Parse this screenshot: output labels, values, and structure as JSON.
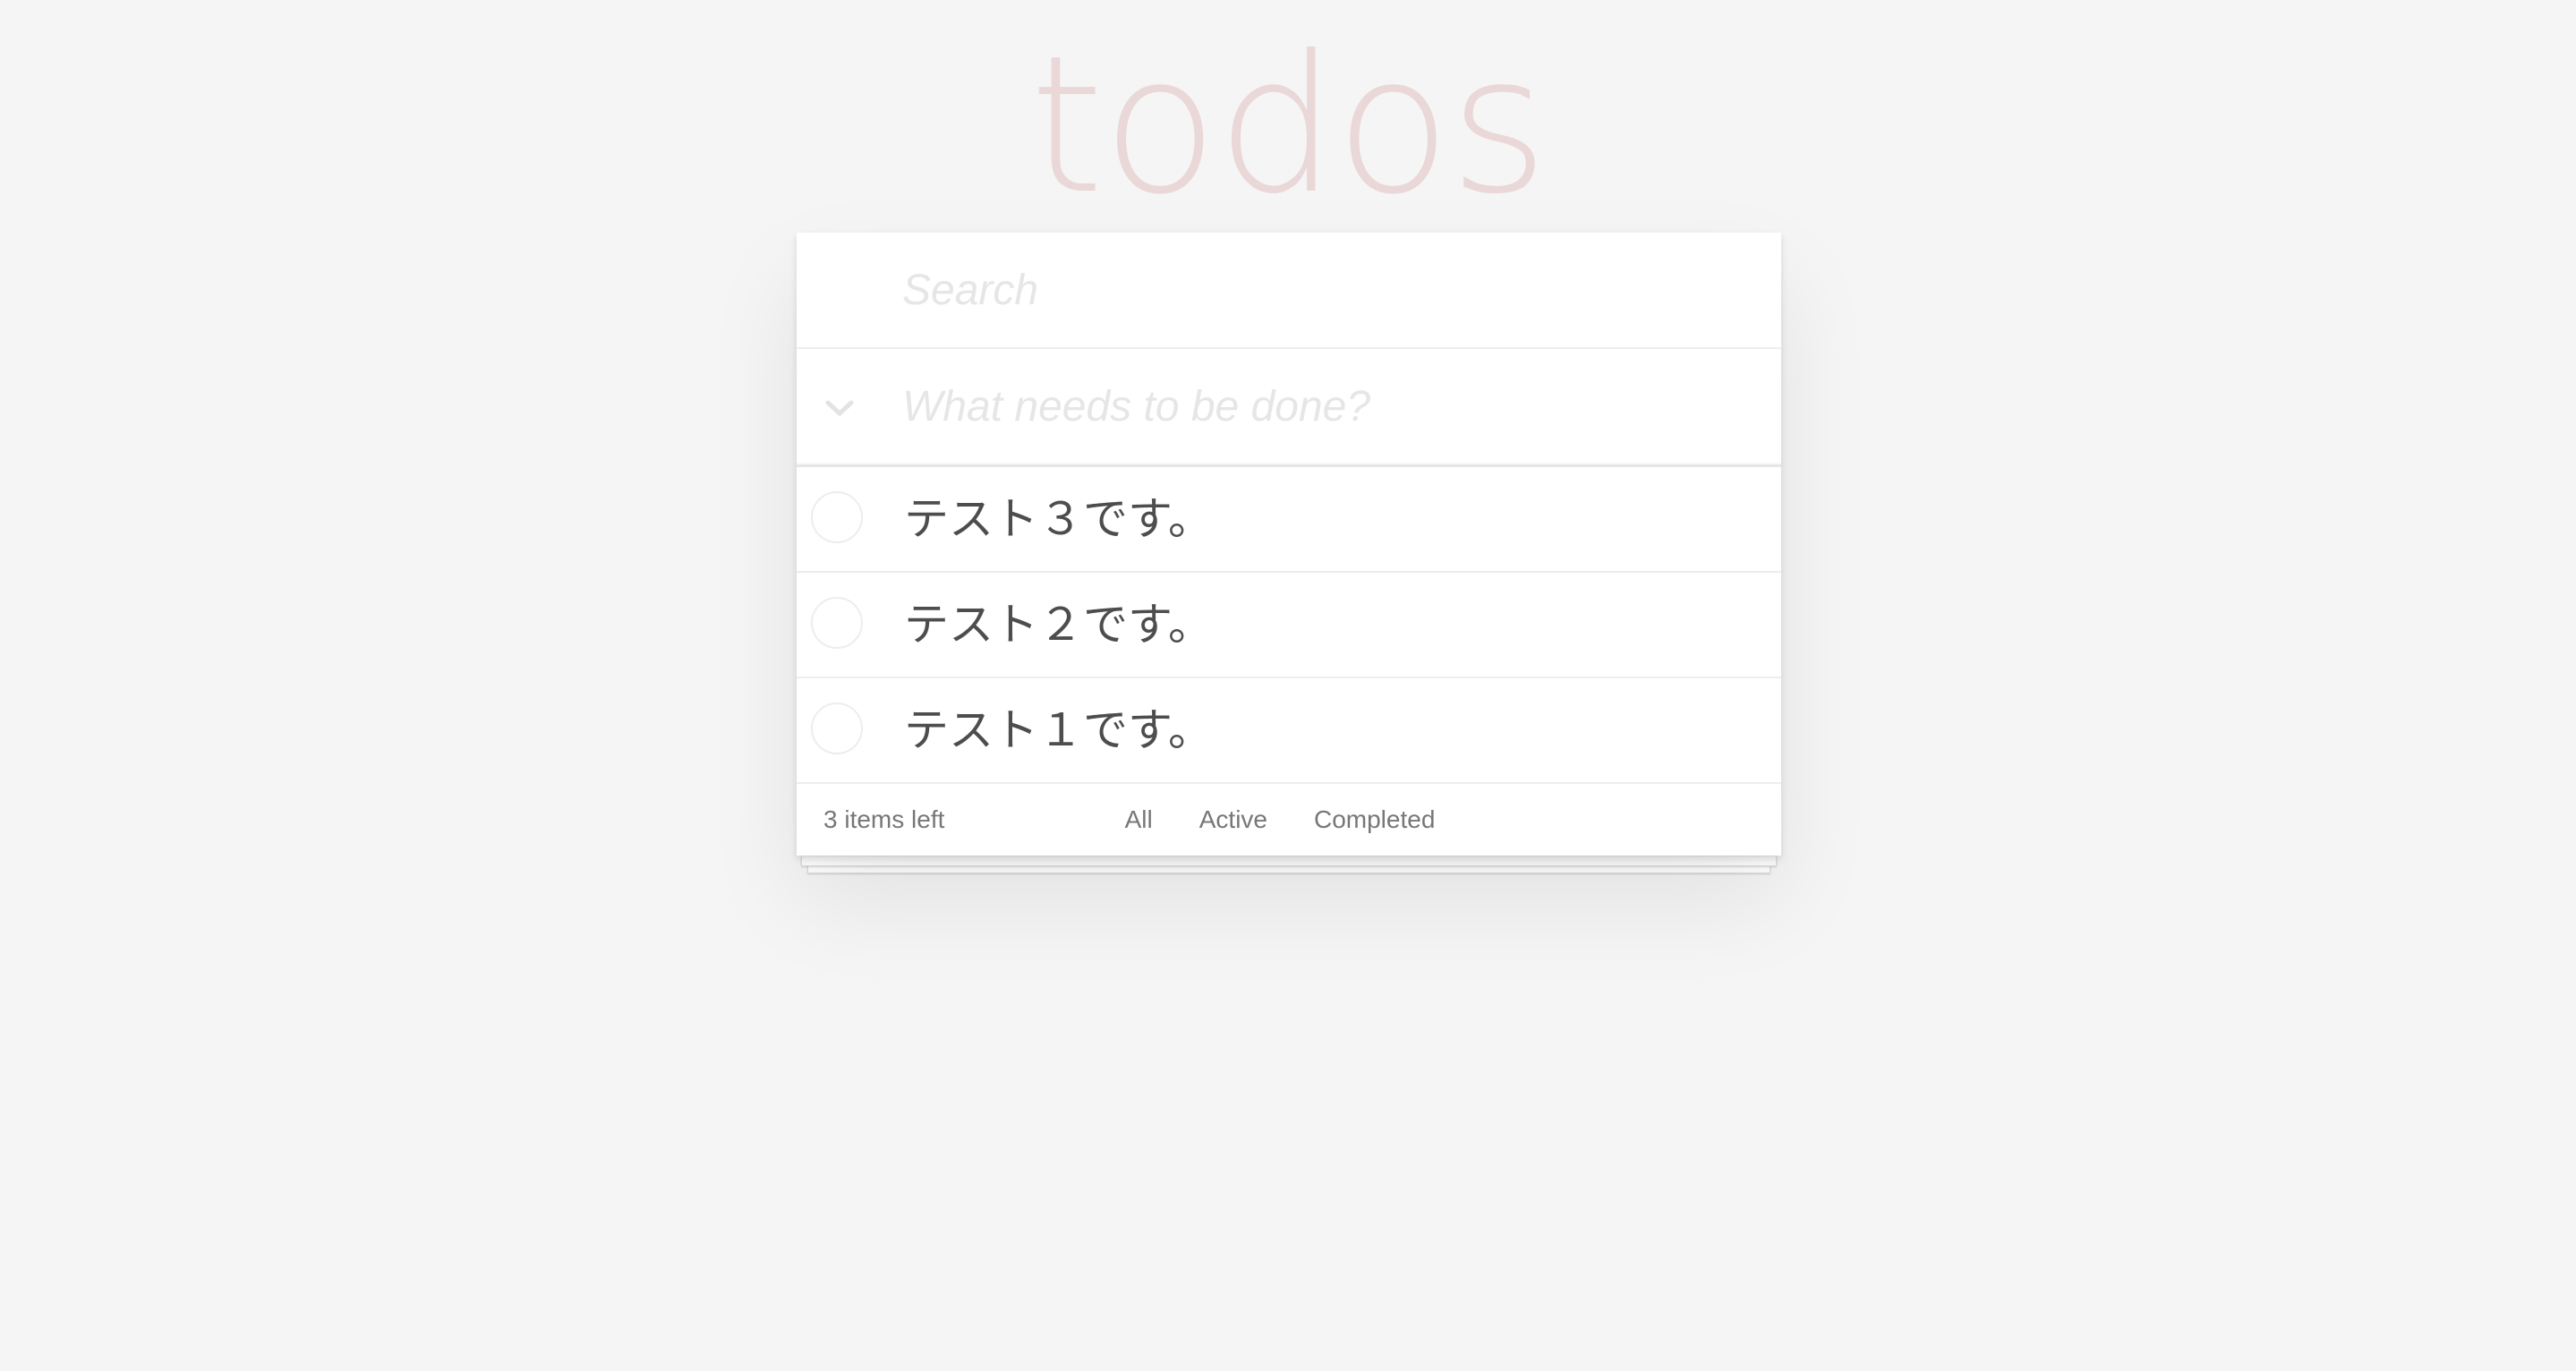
{
  "header": {
    "title": "todos"
  },
  "search": {
    "placeholder": "Search",
    "value": ""
  },
  "new_todo": {
    "placeholder": "What needs to be done?",
    "value": "",
    "toggle_icon": "chevron-down-icon"
  },
  "todos": [
    {
      "label": "テスト３です。",
      "completed": false
    },
    {
      "label": "テスト２です。",
      "completed": false
    },
    {
      "label": "テスト１です。",
      "completed": false
    }
  ],
  "footer": {
    "items_left": "3 items left",
    "filters": [
      {
        "label": "All"
      },
      {
        "label": "Active"
      },
      {
        "label": "Completed"
      }
    ]
  },
  "colors": {
    "background": "#f5f5f5",
    "title": "#ead7d7",
    "card": "#ffffff",
    "text": "#4d4d4d",
    "muted": "#777777",
    "placeholder": "#e6e6e6",
    "border": "#ededed"
  }
}
